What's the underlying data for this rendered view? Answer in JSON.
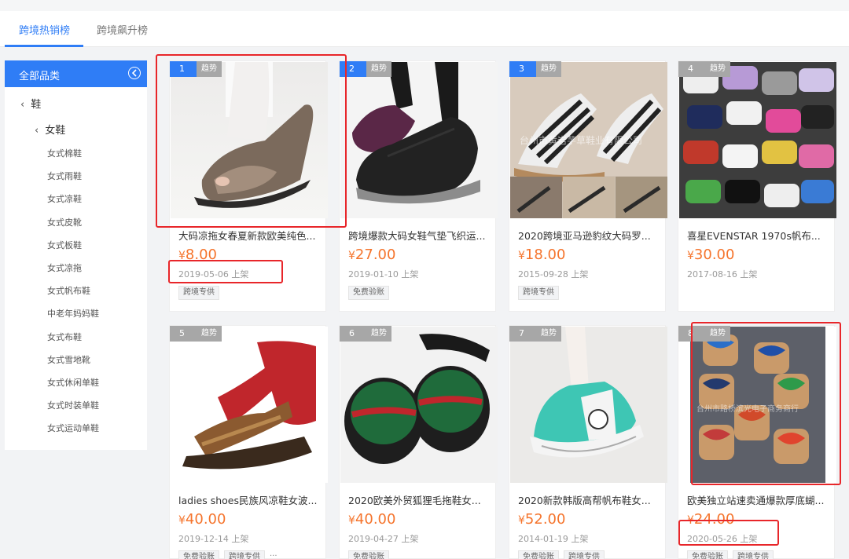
{
  "tabs": [
    {
      "label": "跨境热销榜",
      "active": true
    },
    {
      "label": "跨境飙升榜",
      "active": false
    }
  ],
  "sidebar": {
    "header": "全部品类",
    "level1": "鞋",
    "level2": "女鞋",
    "items": [
      "女式棉鞋",
      "女式雨鞋",
      "女式凉鞋",
      "女式皮靴",
      "女式板鞋",
      "女式凉拖",
      "女式帆布鞋",
      "中老年妈妈鞋",
      "女式布鞋",
      "女式雪地靴",
      "女式休闲单鞋",
      "女式时装单鞋",
      "女式运动单鞋"
    ]
  },
  "trend_label": "趋势",
  "currency": "¥",
  "colors": {
    "accent": "#2f7df6",
    "price": "#f5742c",
    "highlight": "#e8262a"
  },
  "products": [
    {
      "rank": "1",
      "title": "大码凉拖女春夏新款欧美纯色...",
      "price": "8.00",
      "date": "2019-05-06 上架",
      "tags": [
        "跨境专供"
      ],
      "more": ""
    },
    {
      "rank": "2",
      "title": "跨境爆款大码女鞋气垫飞织运...",
      "price": "27.00",
      "date": "2019-01-10 上架",
      "tags": [
        "免费验账"
      ],
      "more": ""
    },
    {
      "rank": "3",
      "title": "2020跨境亚马逊豹纹大码罗...",
      "price": "18.00",
      "date": "2015-09-28 上架",
      "tags": [
        "跨境专供"
      ],
      "more": ""
    },
    {
      "rank": "4",
      "title": "喜星EVENSTAR 1970s帆布...",
      "price": "30.00",
      "date": "2017-08-16 上架",
      "tags": [],
      "more": ""
    },
    {
      "rank": "5",
      "title": "ladies shoes民族风凉鞋女波...",
      "price": "40.00",
      "date": "2019-12-14 上架",
      "tags": [
        "免费验账",
        "跨境专供"
      ],
      "more": "···"
    },
    {
      "rank": "6",
      "title": "2020欧美外贸狐狸毛拖鞋女...",
      "price": "40.00",
      "date": "2019-04-27 上架",
      "tags": [
        "免费验账"
      ],
      "more": ""
    },
    {
      "rank": "7",
      "title": "2020新款韩版高帮帆布鞋女...",
      "price": "52.00",
      "date": "2014-01-19 上架",
      "tags": [
        "免费验账",
        "跨境专供"
      ],
      "more": ""
    },
    {
      "rank": "8",
      "title": "欧美独立站速卖通爆款厚底蝴...",
      "price": "24.00",
      "date": "2020-05-26 上架",
      "tags": [
        "免费验账",
        "跨境专供"
      ],
      "more": ""
    }
  ],
  "watermarks": [
    "台州市黄岩芋草鞋业有限公司",
    "台州市路桥滨光电子商务商行"
  ]
}
